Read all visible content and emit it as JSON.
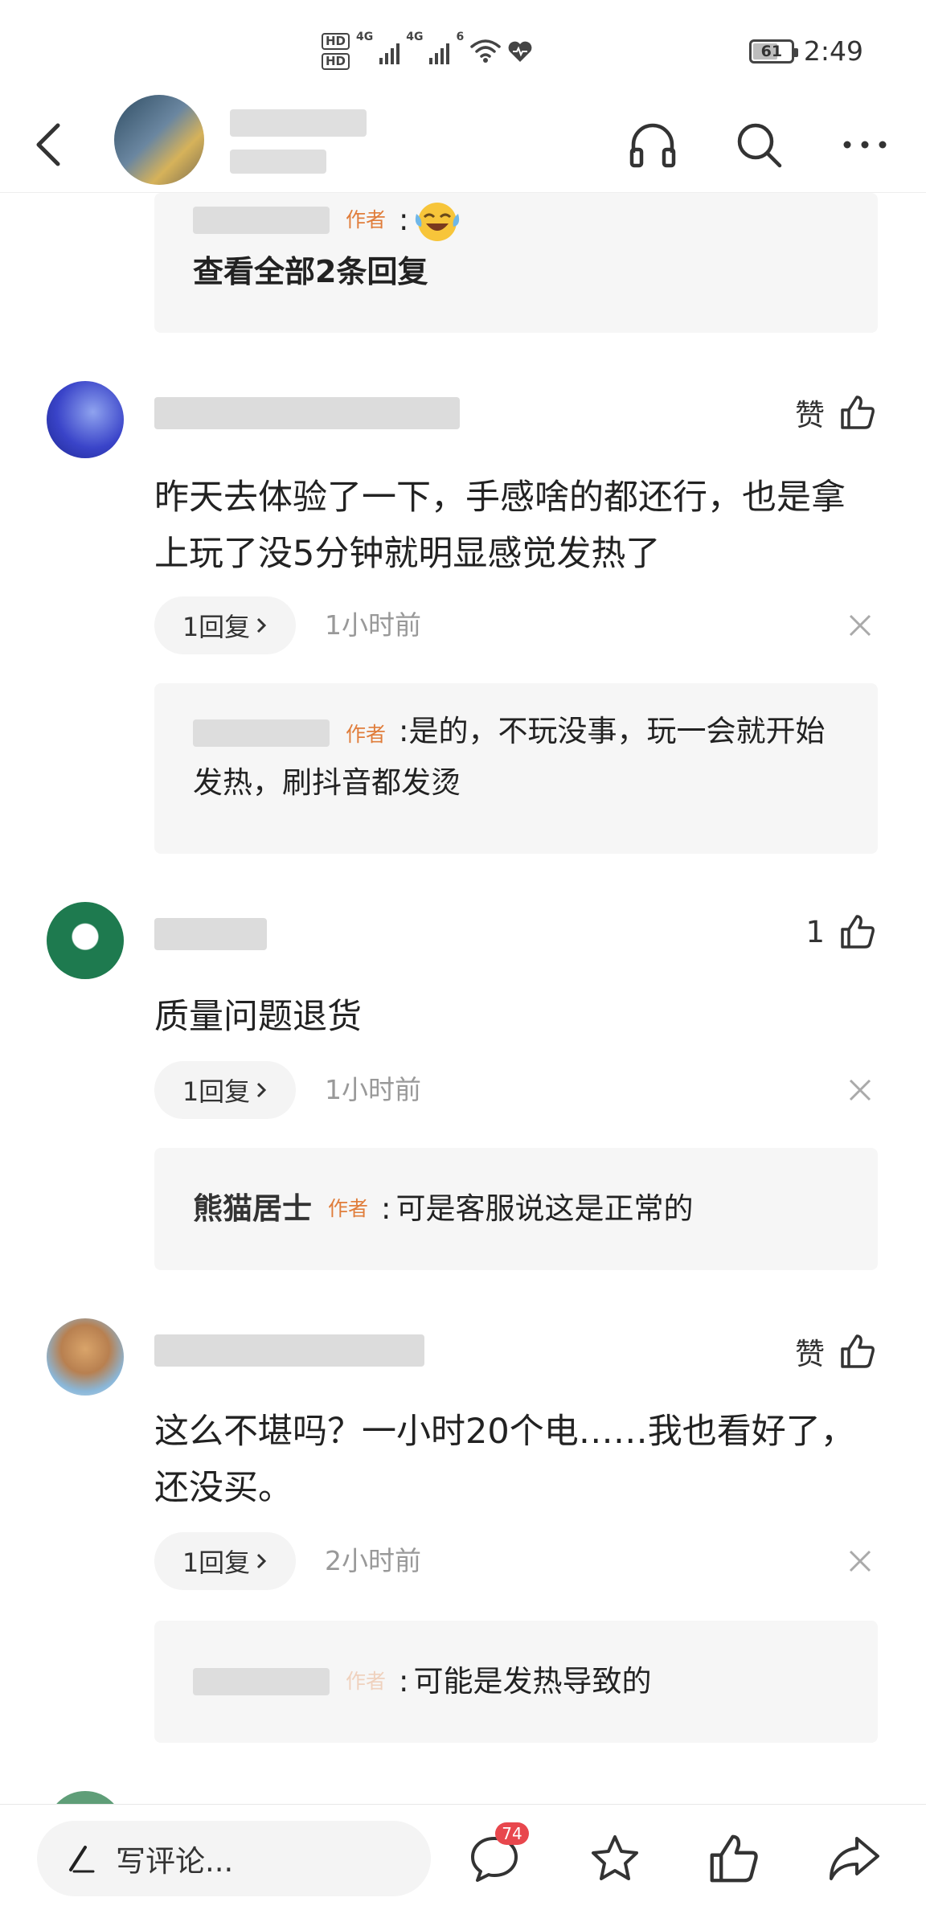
{
  "status_bar": {
    "hd1": "HD",
    "hd2": "HD",
    "net1": "4G",
    "net2": "4G",
    "wifi_label": "6",
    "battery_level": "61",
    "battery_fraction": 0.61,
    "time": "2:49"
  },
  "nav": {
    "back_icon": "chevron-left-icon",
    "actions": [
      "headphones-icon",
      "search-icon",
      "more-icon"
    ]
  },
  "top_reply": {
    "author_tag": "作者",
    "separator": ":",
    "emoji": "crying-laughing-emoji",
    "view_all": "查看全部2条回复"
  },
  "comments": [
    {
      "like_label": "赞",
      "text": "昨天去体验了一下，手感啥的都还行，也是拿上玩了没5分钟就明显感觉发热了",
      "reply_button": "1回复",
      "time": "1小时前",
      "reply": {
        "name": "",
        "author_tag": "作者",
        "separator": ":",
        "text": "是的，不玩没事，玩一会就开始发热，刷抖音都发烫"
      }
    },
    {
      "like_label": "1",
      "text": "质量问题退货",
      "reply_button": "1回复",
      "time": "1小时前",
      "reply": {
        "name": "熊猫居士",
        "author_tag": "作者",
        "separator": ":",
        "text": "可是客服说这是正常的"
      }
    },
    {
      "like_label": "赞",
      "text": "这么不堪吗？一小时20个电……我也看好了，还没买。",
      "reply_button": "1回复",
      "time": "2小时前",
      "reply": {
        "name": "",
        "author_tag": "作者",
        "separator": ":",
        "text": "可能是发热导致的"
      }
    }
  ],
  "bottom_bar": {
    "write_placeholder": "写评论...",
    "comment_count": "74",
    "icons": [
      "pen-icon",
      "comment-icon",
      "star-icon",
      "thumbs-up-icon",
      "share-icon"
    ]
  },
  "colors": {
    "author_tag": "#e07d3b",
    "badge": "#e8474d",
    "reply_box": "#f6f6f6",
    "muted_text": "#999999"
  }
}
